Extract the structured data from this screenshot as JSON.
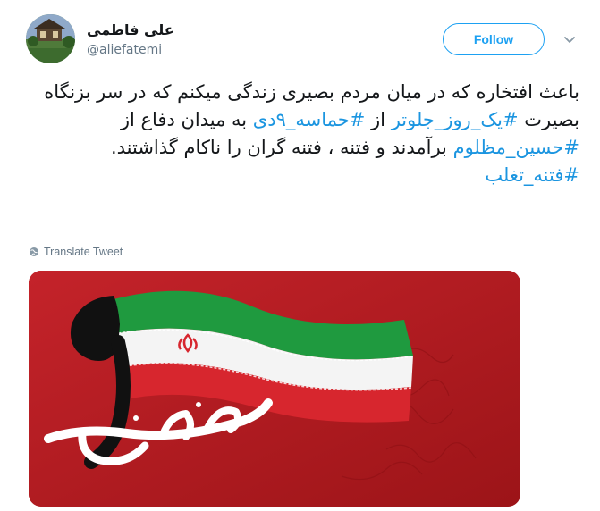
{
  "author": {
    "display_name": "علی فاطمی",
    "handle": "@aliefatemi"
  },
  "actions": {
    "follow_label": "Follow"
  },
  "tweet": {
    "text_parts": [
      "باعث افتخاره که در میان مردم بصیری زندگی میکنم که در سر بزنگاه بصیرت ",
      "#یک_روز_جلوتر",
      " از ",
      "#حماسه_۹دی",
      " به میدان دفاع از ",
      "#حسین_مظلوم",
      " برآمدند و فتنه ، فتنه گران را ناکام گذاشتند. ",
      "#فتنه_تغلب"
    ],
    "translate_label": "Translate Tweet"
  },
  "media": {
    "artwork_digit": "۹",
    "artwork_word": "حماسه دی"
  },
  "colors": {
    "accent": "#1da1f2",
    "hashtag": "#1b95e0",
    "text": "#14171a",
    "muted": "#657786",
    "media_bg": "#b01a1e"
  },
  "icons": {
    "chevron": "chevron-down-icon",
    "globe": "globe-icon"
  }
}
